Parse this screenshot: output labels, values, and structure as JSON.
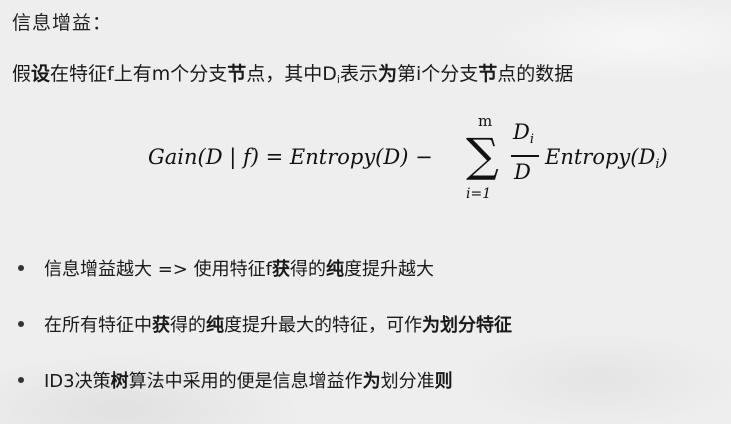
{
  "slide": {
    "title": "信息增益：",
    "description": {
      "part1": "假",
      "part2": "设",
      "part3": "在特征f上有m个分支",
      "part4": "节",
      "part5": "点，其中D",
      "part5_sub": "i",
      "part6": "表示",
      "part7": "为",
      "part8": "第i个分支",
      "part9": "节",
      "part10": "点的数据"
    },
    "formula": {
      "lhs": "Gain(D | f) = Entropy(D) −",
      "sum_upper": "m",
      "sum_lower": "i=1",
      "num": "D",
      "num_sub": "i",
      "den": "D",
      "tail": "Entropy(D",
      "tail_sub": "i",
      "tail_end": ")"
    },
    "bullets": [
      {
        "a": "信息增益越大 => 使用特征f",
        "b": "获",
        "c": "得的",
        "d": "纯",
        "e": "度提升越大",
        "f": ""
      },
      {
        "a": "在所有特征中",
        "b": "获",
        "c": "得的",
        "d": "纯",
        "e": "度提升最大的特征，可作",
        "f": "为划分特征"
      },
      {
        "a": "ID3决策",
        "b": "树",
        "c": "算法中采用的便是信息增益作",
        "d": "为",
        "e": "划分准",
        "f": "则"
      }
    ]
  }
}
